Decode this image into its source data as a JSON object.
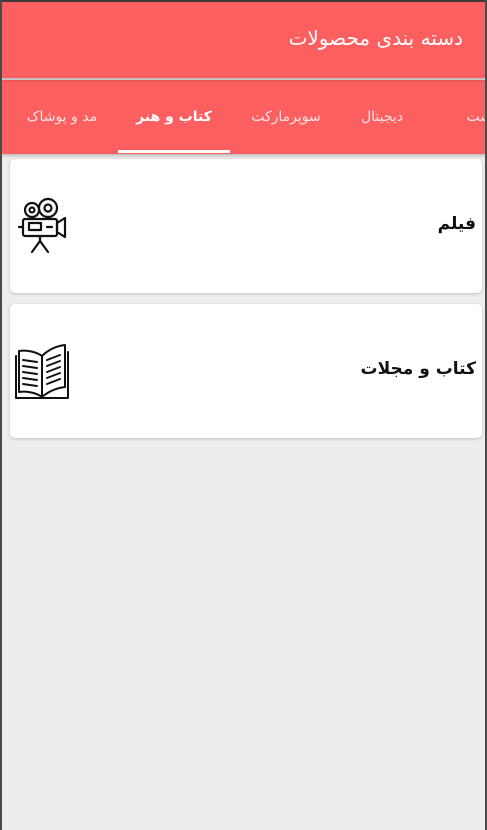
{
  "appbar": {
    "title": "دسته بندی محصولات"
  },
  "tabs": [
    {
      "label": "مد و پوشاک",
      "active": false
    },
    {
      "label": "کتاب و هنر",
      "active": true
    },
    {
      "label": "سوپرمارکت",
      "active": false
    },
    {
      "label": "دیجیتال",
      "active": false
    },
    {
      "label": "بهداشت",
      "active": false
    }
  ],
  "categories": [
    {
      "label": "فیلم",
      "icon": "movie-camera-icon"
    },
    {
      "label": "کتاب و مجلات",
      "icon": "open-book-icon"
    }
  ],
  "colors": {
    "primary": "#fc5f5f",
    "background": "#eeecec",
    "card": "#ffffff"
  }
}
